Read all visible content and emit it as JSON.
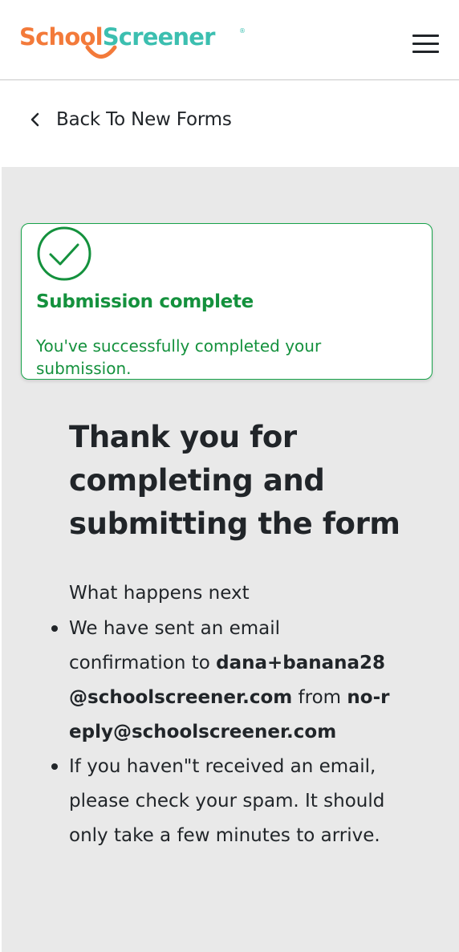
{
  "header": {
    "logo": {
      "text_part1": "School",
      "text_part2": "Screener",
      "trademark": "®"
    },
    "menu_icon": "hamburger-menu-icon"
  },
  "nav": {
    "back_icon": "chevron-left-icon",
    "back_label": "Back To New Forms"
  },
  "alert": {
    "icon": "check-circle-icon",
    "title": "Submission complete",
    "message": "You've successfully completed your submission."
  },
  "thanks": {
    "title": "Thank you for completing and submitting the form",
    "next_heading": "What happens next",
    "item1": {
      "prefix": "We have sent an email confirmation to ",
      "email": "dana+banana28@schoolscreener.com",
      "middle": " from ",
      "sender": "no-reply@schoolscreener.com"
    },
    "item2": "If you haven\"t received an email, please check your spam. It should only take a few minutes to arrive."
  },
  "colors": {
    "brand_orange": "#f37a3a",
    "brand_teal": "#3cbfb0",
    "success_green": "#14913d",
    "background_gray": "#e9e9e9",
    "text_dark": "#212529"
  }
}
